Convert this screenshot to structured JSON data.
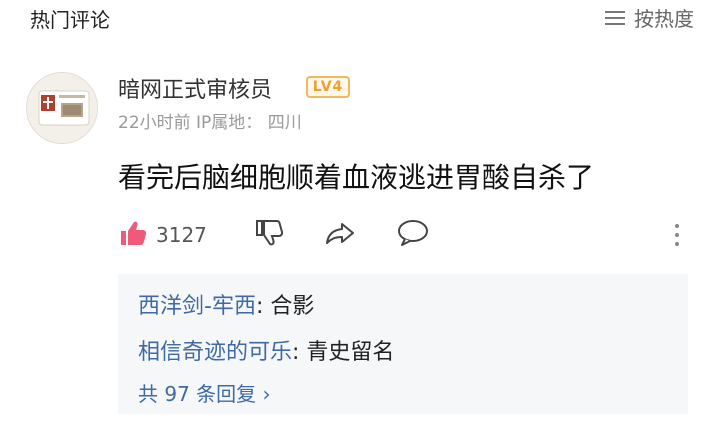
{
  "header": {
    "title": "热门评论",
    "sort_label": "按热度"
  },
  "comment": {
    "username": "暗网正式审核员",
    "level_badge": "LV4",
    "time": "22小时前",
    "ip_label": "IP属地：",
    "ip_location": "四川",
    "text": "看完后脑细胞顺着血液逃进胃酸自杀了",
    "like_count": "3127",
    "icons": {
      "like": "thumbs-up-filled-icon",
      "dislike": "thumbs-down-icon",
      "share": "share-arrow-icon",
      "reply": "chat-bubble-icon",
      "more": "vertical-dots-icon",
      "sort": "sort-lines-icon"
    },
    "colors": {
      "like": "#ef5a7a",
      "accent_link": "#3f6aa6",
      "badge": "#f0a030"
    }
  },
  "replies": {
    "items": [
      {
        "user": "西洋剑-牢西",
        "text": "合影"
      },
      {
        "user": "相信奇迹的可乐",
        "text": "青史留名"
      }
    ],
    "more_label": "共 97 条回复 ›"
  }
}
